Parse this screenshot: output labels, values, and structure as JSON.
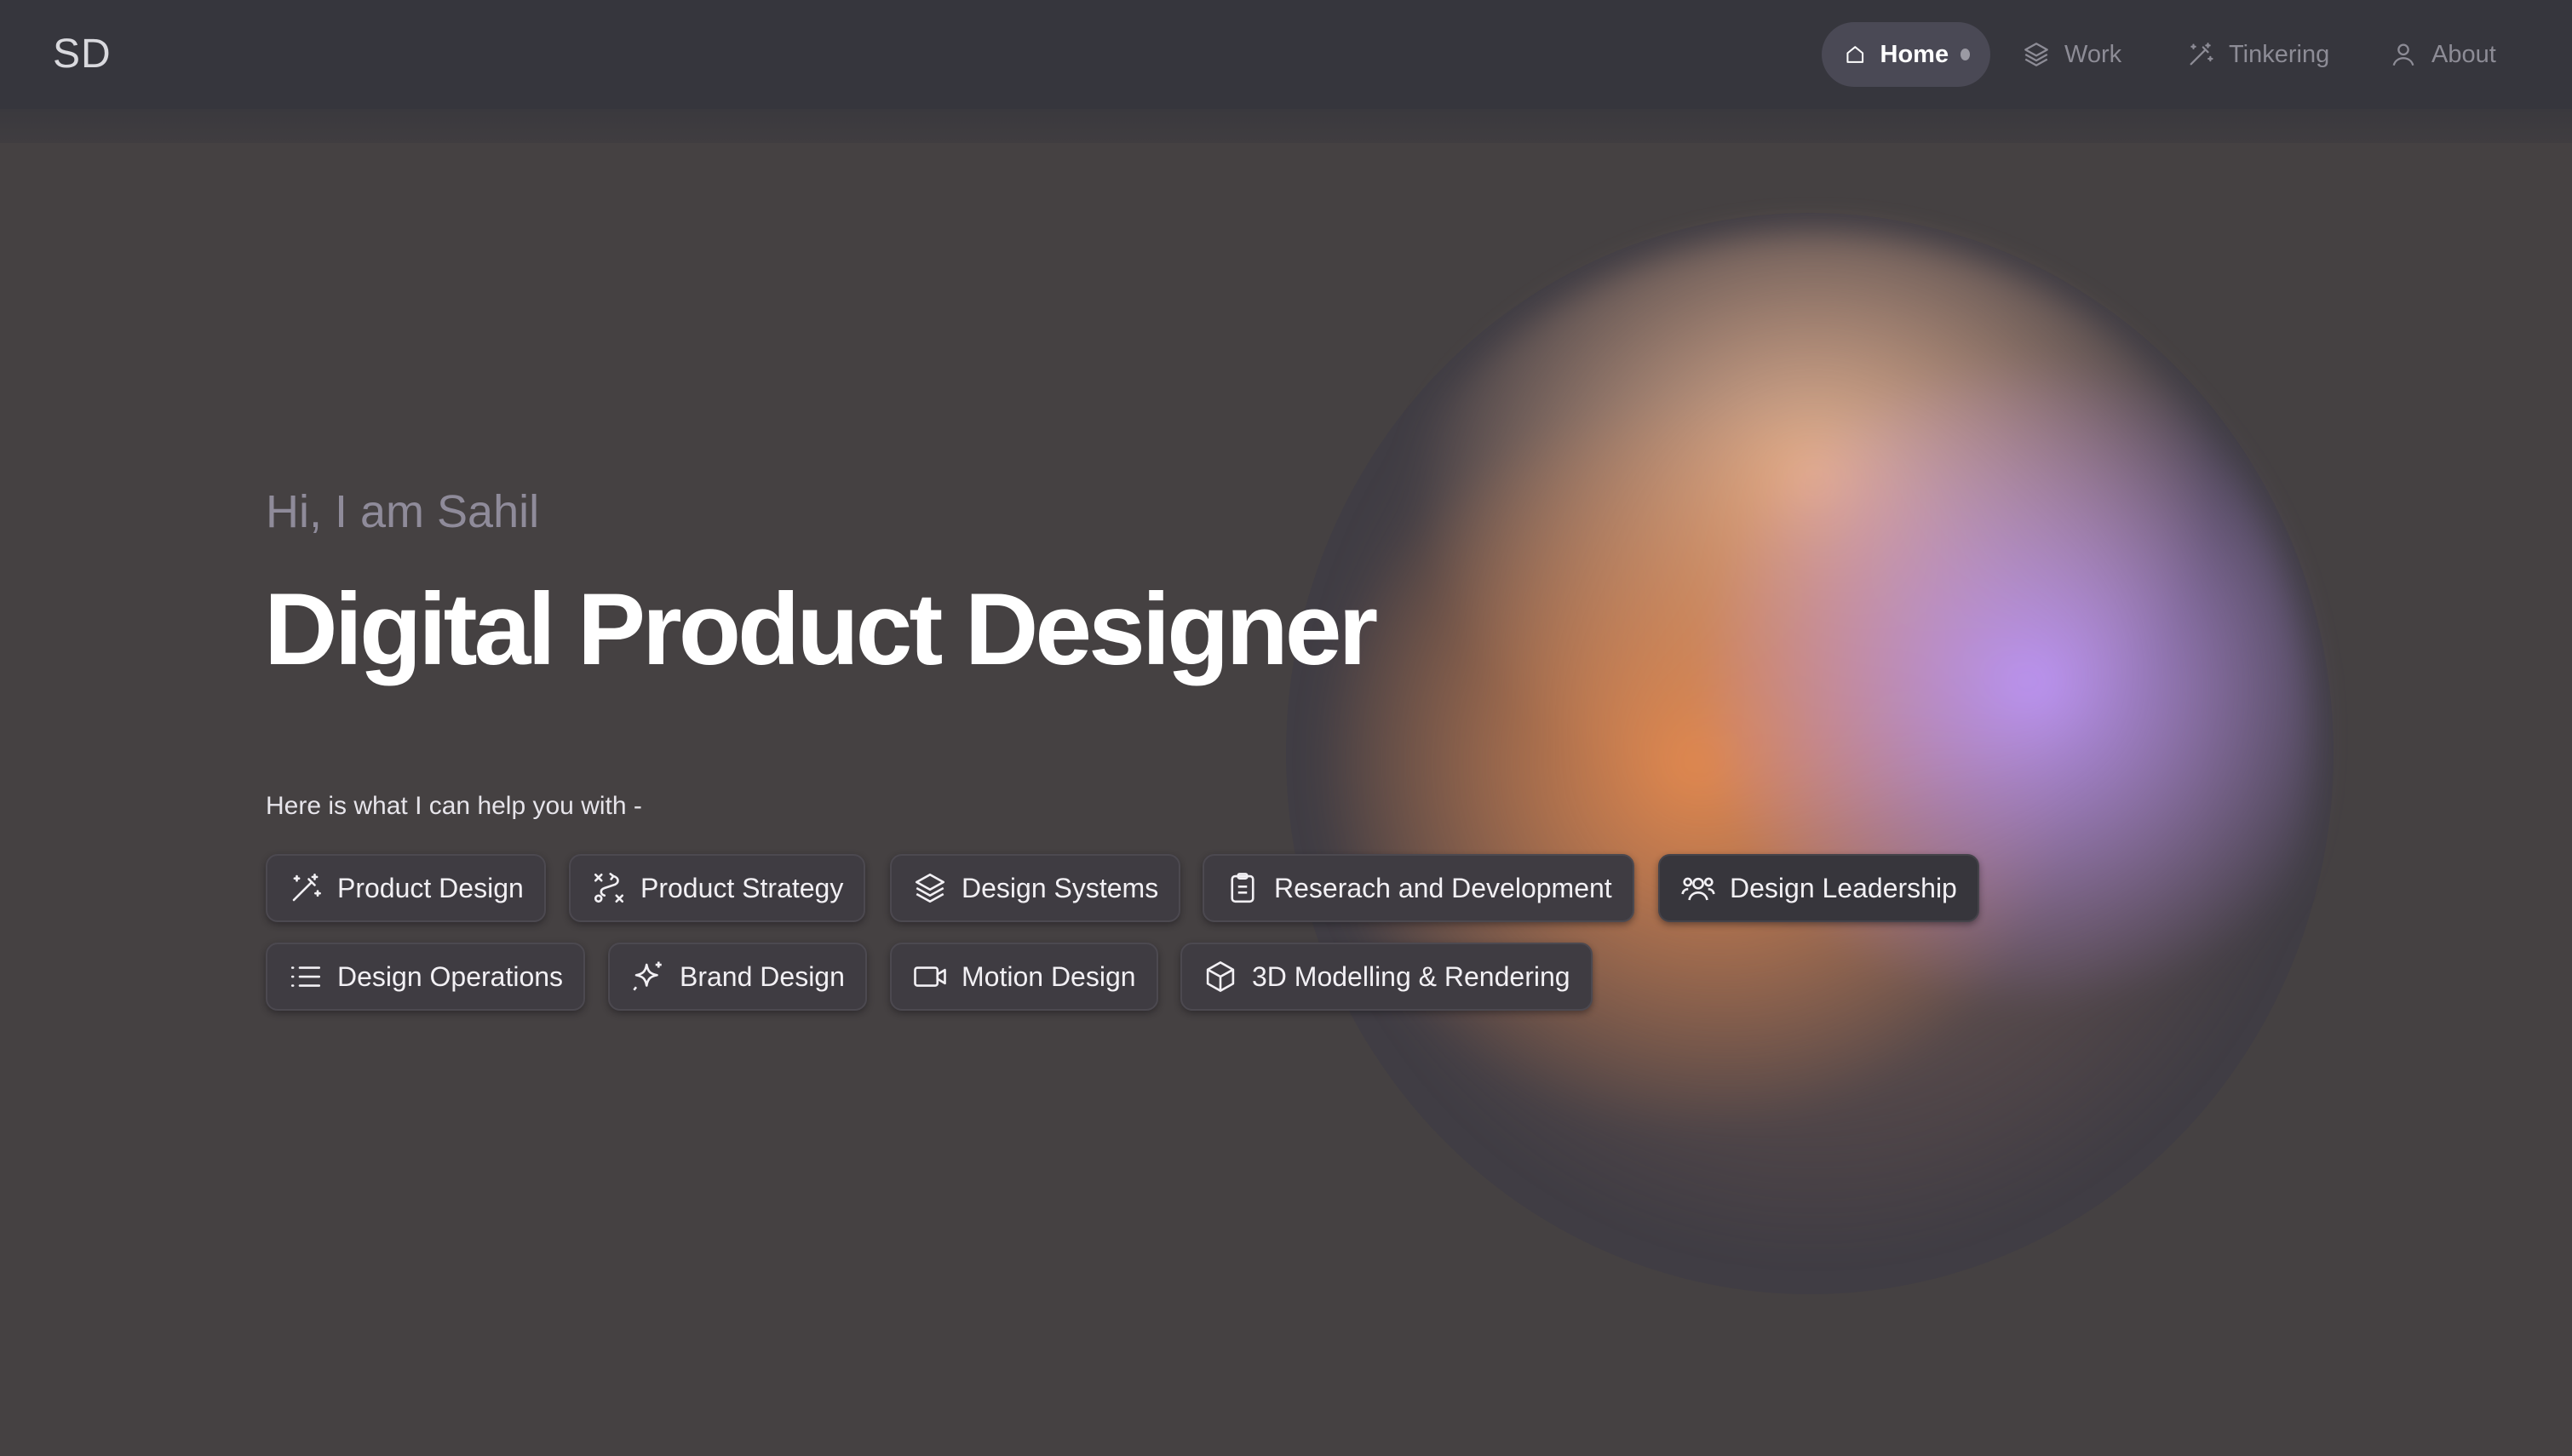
{
  "header": {
    "logo": "SD",
    "nav": [
      {
        "label": "Home",
        "icon": "home-icon",
        "active": true
      },
      {
        "label": "Work",
        "icon": "layers-icon",
        "active": false
      },
      {
        "label": "Tinkering",
        "icon": "magic-wand-icon",
        "active": false
      },
      {
        "label": "About",
        "icon": "user-icon",
        "active": false
      }
    ]
  },
  "hero": {
    "greeting": "Hi, I am Sahil",
    "headline": "Digital Product Designer",
    "help_text": "Here is what I can help you with -"
  },
  "services": [
    {
      "label": "Product Design",
      "icon": "magic-wand-icon"
    },
    {
      "label": "Product Strategy",
      "icon": "route-icon"
    },
    {
      "label": "Design Systems",
      "icon": "layers-icon"
    },
    {
      "label": "Reserach and Development",
      "icon": "clipboard-icon"
    },
    {
      "label": "Design Leadership",
      "icon": "users-icon"
    },
    {
      "label": "Design Operations",
      "icon": "list-icon"
    },
    {
      "label": "Brand Design",
      "icon": "sparkle-icon"
    },
    {
      "label": "Motion Design",
      "icon": "video-icon"
    },
    {
      "label": "3D Modelling & Rendering",
      "icon": "cube-icon"
    }
  ],
  "colors": {
    "background": "#454142",
    "header": "#36363d",
    "active_nav": "#4a4955",
    "blob_orange": "#e68a4e",
    "blob_peach": "#eeb996",
    "blob_purple": "#be96fa"
  }
}
